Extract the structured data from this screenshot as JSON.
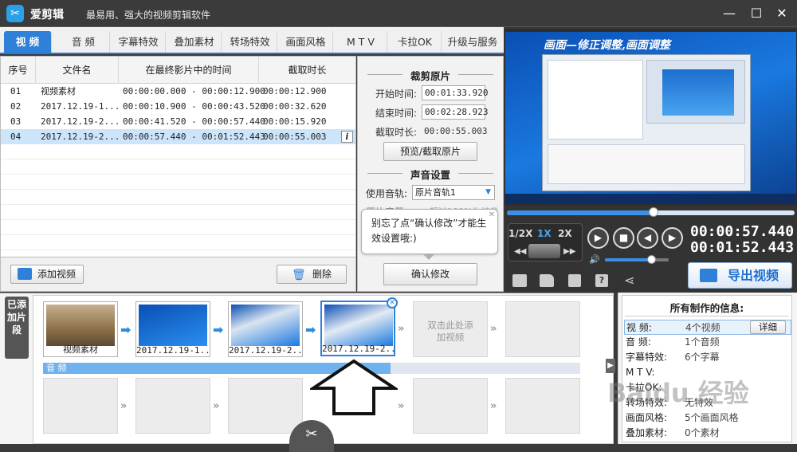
{
  "app": {
    "logo_glyph": "✂",
    "title": "爱剪辑",
    "slogan": "最易用、强大的视频剪辑软件"
  },
  "window_controls": {
    "minimize": "—",
    "maximize": "☐",
    "close": "✕"
  },
  "tabs": [
    {
      "label": "视 频",
      "active": true
    },
    {
      "label": "音 频"
    },
    {
      "label": "字幕特效"
    },
    {
      "label": "叠加素材"
    },
    {
      "label": "转场特效"
    },
    {
      "label": "画面风格"
    },
    {
      "label": "M T V"
    },
    {
      "label": "卡拉OK"
    },
    {
      "label": "升级与服务"
    }
  ],
  "clip_table": {
    "columns": [
      "序号",
      "文件名",
      "在最终影片中的时间",
      "截取时长"
    ],
    "rows": [
      {
        "no": "01",
        "file": "视频素材",
        "time": "00:00:00.000 - 00:00:12.900",
        "dur": "00:00:12.900"
      },
      {
        "no": "02",
        "file": "2017.12.19-1...",
        "time": "00:00:10.900 - 00:00:43.520",
        "dur": "00:00:32.620"
      },
      {
        "no": "03",
        "file": "2017.12.19-2...",
        "time": "00:00:41.520 - 00:00:57.440",
        "dur": "00:00:15.920"
      },
      {
        "no": "04",
        "file": "2017.12.19-2...",
        "time": "00:00:57.440 - 00:01:52.443",
        "dur": "00:00:55.003",
        "selected": true
      }
    ],
    "info_glyph": "i"
  },
  "clip_actions": {
    "add": "添加视频",
    "delete": "删除"
  },
  "trim": {
    "title": "裁剪原片",
    "start_label": "开始时间:",
    "start_value": "00:01:33.920",
    "end_label": "结束时间:",
    "end_value": "00:02:28.923",
    "dur_label": "截取时长:",
    "dur_value": "00:00:55.003",
    "preview_button": "预览/截取原片"
  },
  "sound": {
    "title": "声音设置",
    "track_label": "使用音轨:",
    "track_value": "原片音轨1",
    "volume_label": "原片音量:",
    "volume_hint": "超过100%为扩音"
  },
  "tooltip": {
    "text": "别忘了点“确认修改”才能生效设置哦:)",
    "close": "✕"
  },
  "confirm_button": "确认修改",
  "preview": {
    "caption": "画面—修正调整,画面调整",
    "progress": 0.51,
    "speeds": [
      "1/2X",
      "1X",
      "2X"
    ],
    "active_speed": "1X",
    "time_current": "00:00:57.440",
    "time_total": "00:01:52.443",
    "volume": 0.72,
    "export_label": "导出视频"
  },
  "timeline": {
    "added_label": "已添加片段",
    "clips": [
      {
        "caption": "视频素材"
      },
      {
        "caption": "2017.12.19-1..."
      },
      {
        "caption": "2017.12.19-2..."
      },
      {
        "caption": "2017.12.19-2...",
        "selected": true
      }
    ],
    "empty_slot_text": "双击此处添加视频",
    "audio_label": "音 频",
    "audio_fill": 0.647
  },
  "info": {
    "title": "所有制作的信息:",
    "detail_button": "详细",
    "items": [
      {
        "k": "视 频:",
        "v": "4个视频",
        "selected": true
      },
      {
        "k": "音 频:",
        "v": "1个音频"
      },
      {
        "k": "字幕特效:",
        "v": "6个字幕"
      },
      {
        "k": "M T V:",
        "v": ""
      },
      {
        "k": "卡拉OK:",
        "v": ""
      },
      {
        "k": "转场特效:",
        "v": "无特效"
      },
      {
        "k": "画面风格:",
        "v": "5个画面风格"
      },
      {
        "k": "叠加素材:",
        "v": "0个素材"
      }
    ]
  },
  "watermark": "Baidu 经验"
}
